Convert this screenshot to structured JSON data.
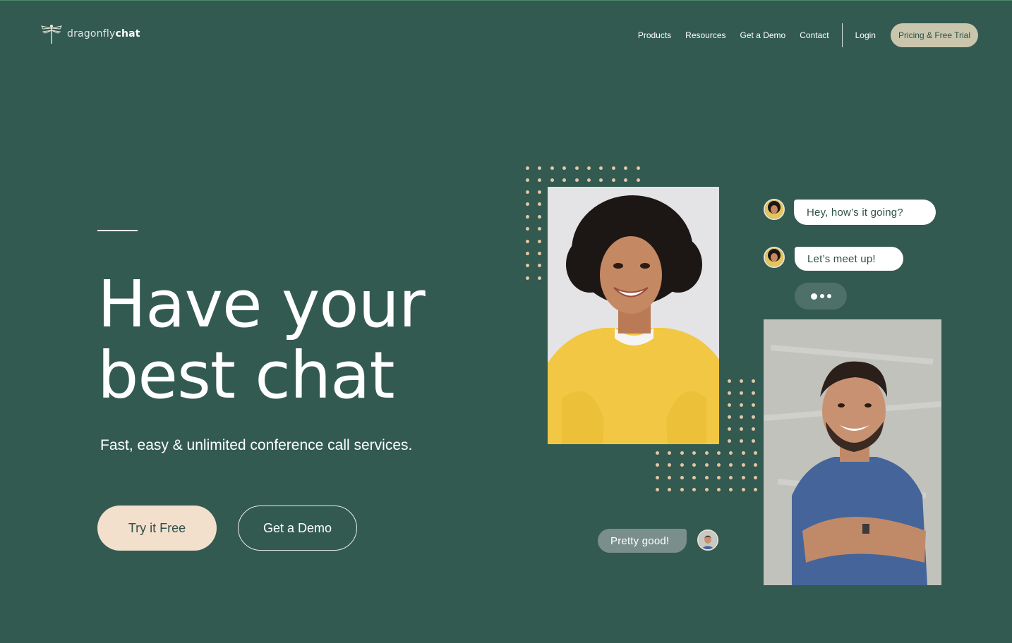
{
  "brand": {
    "name_light": "dragonfly",
    "name_bold": "chat"
  },
  "nav": {
    "links": [
      "Products",
      "Resources",
      "Get a Demo",
      "Contact"
    ],
    "login": "Login",
    "cta": "Pricing & Free Trial"
  },
  "hero": {
    "title_line1": "Have your",
    "title_line2": "best chat",
    "subtitle": "Fast, easy & unlimited conference call services.",
    "primary_button": "Try it Free",
    "secondary_button": "Get a Demo"
  },
  "chat": {
    "messages": [
      {
        "from": "woman",
        "text": "Hey, how’s it going?"
      },
      {
        "from": "woman",
        "text": "Let’s meet up!"
      },
      {
        "from": "man",
        "text": "Pretty good!"
      }
    ],
    "typing_icon": "typing-dots-icon"
  },
  "colors": {
    "background": "#335a51",
    "accent_cream": "#f2dfcc",
    "cta_bg": "#c9c6ad",
    "dots": "#e2c7a6",
    "text_dark": "#2f5149"
  }
}
